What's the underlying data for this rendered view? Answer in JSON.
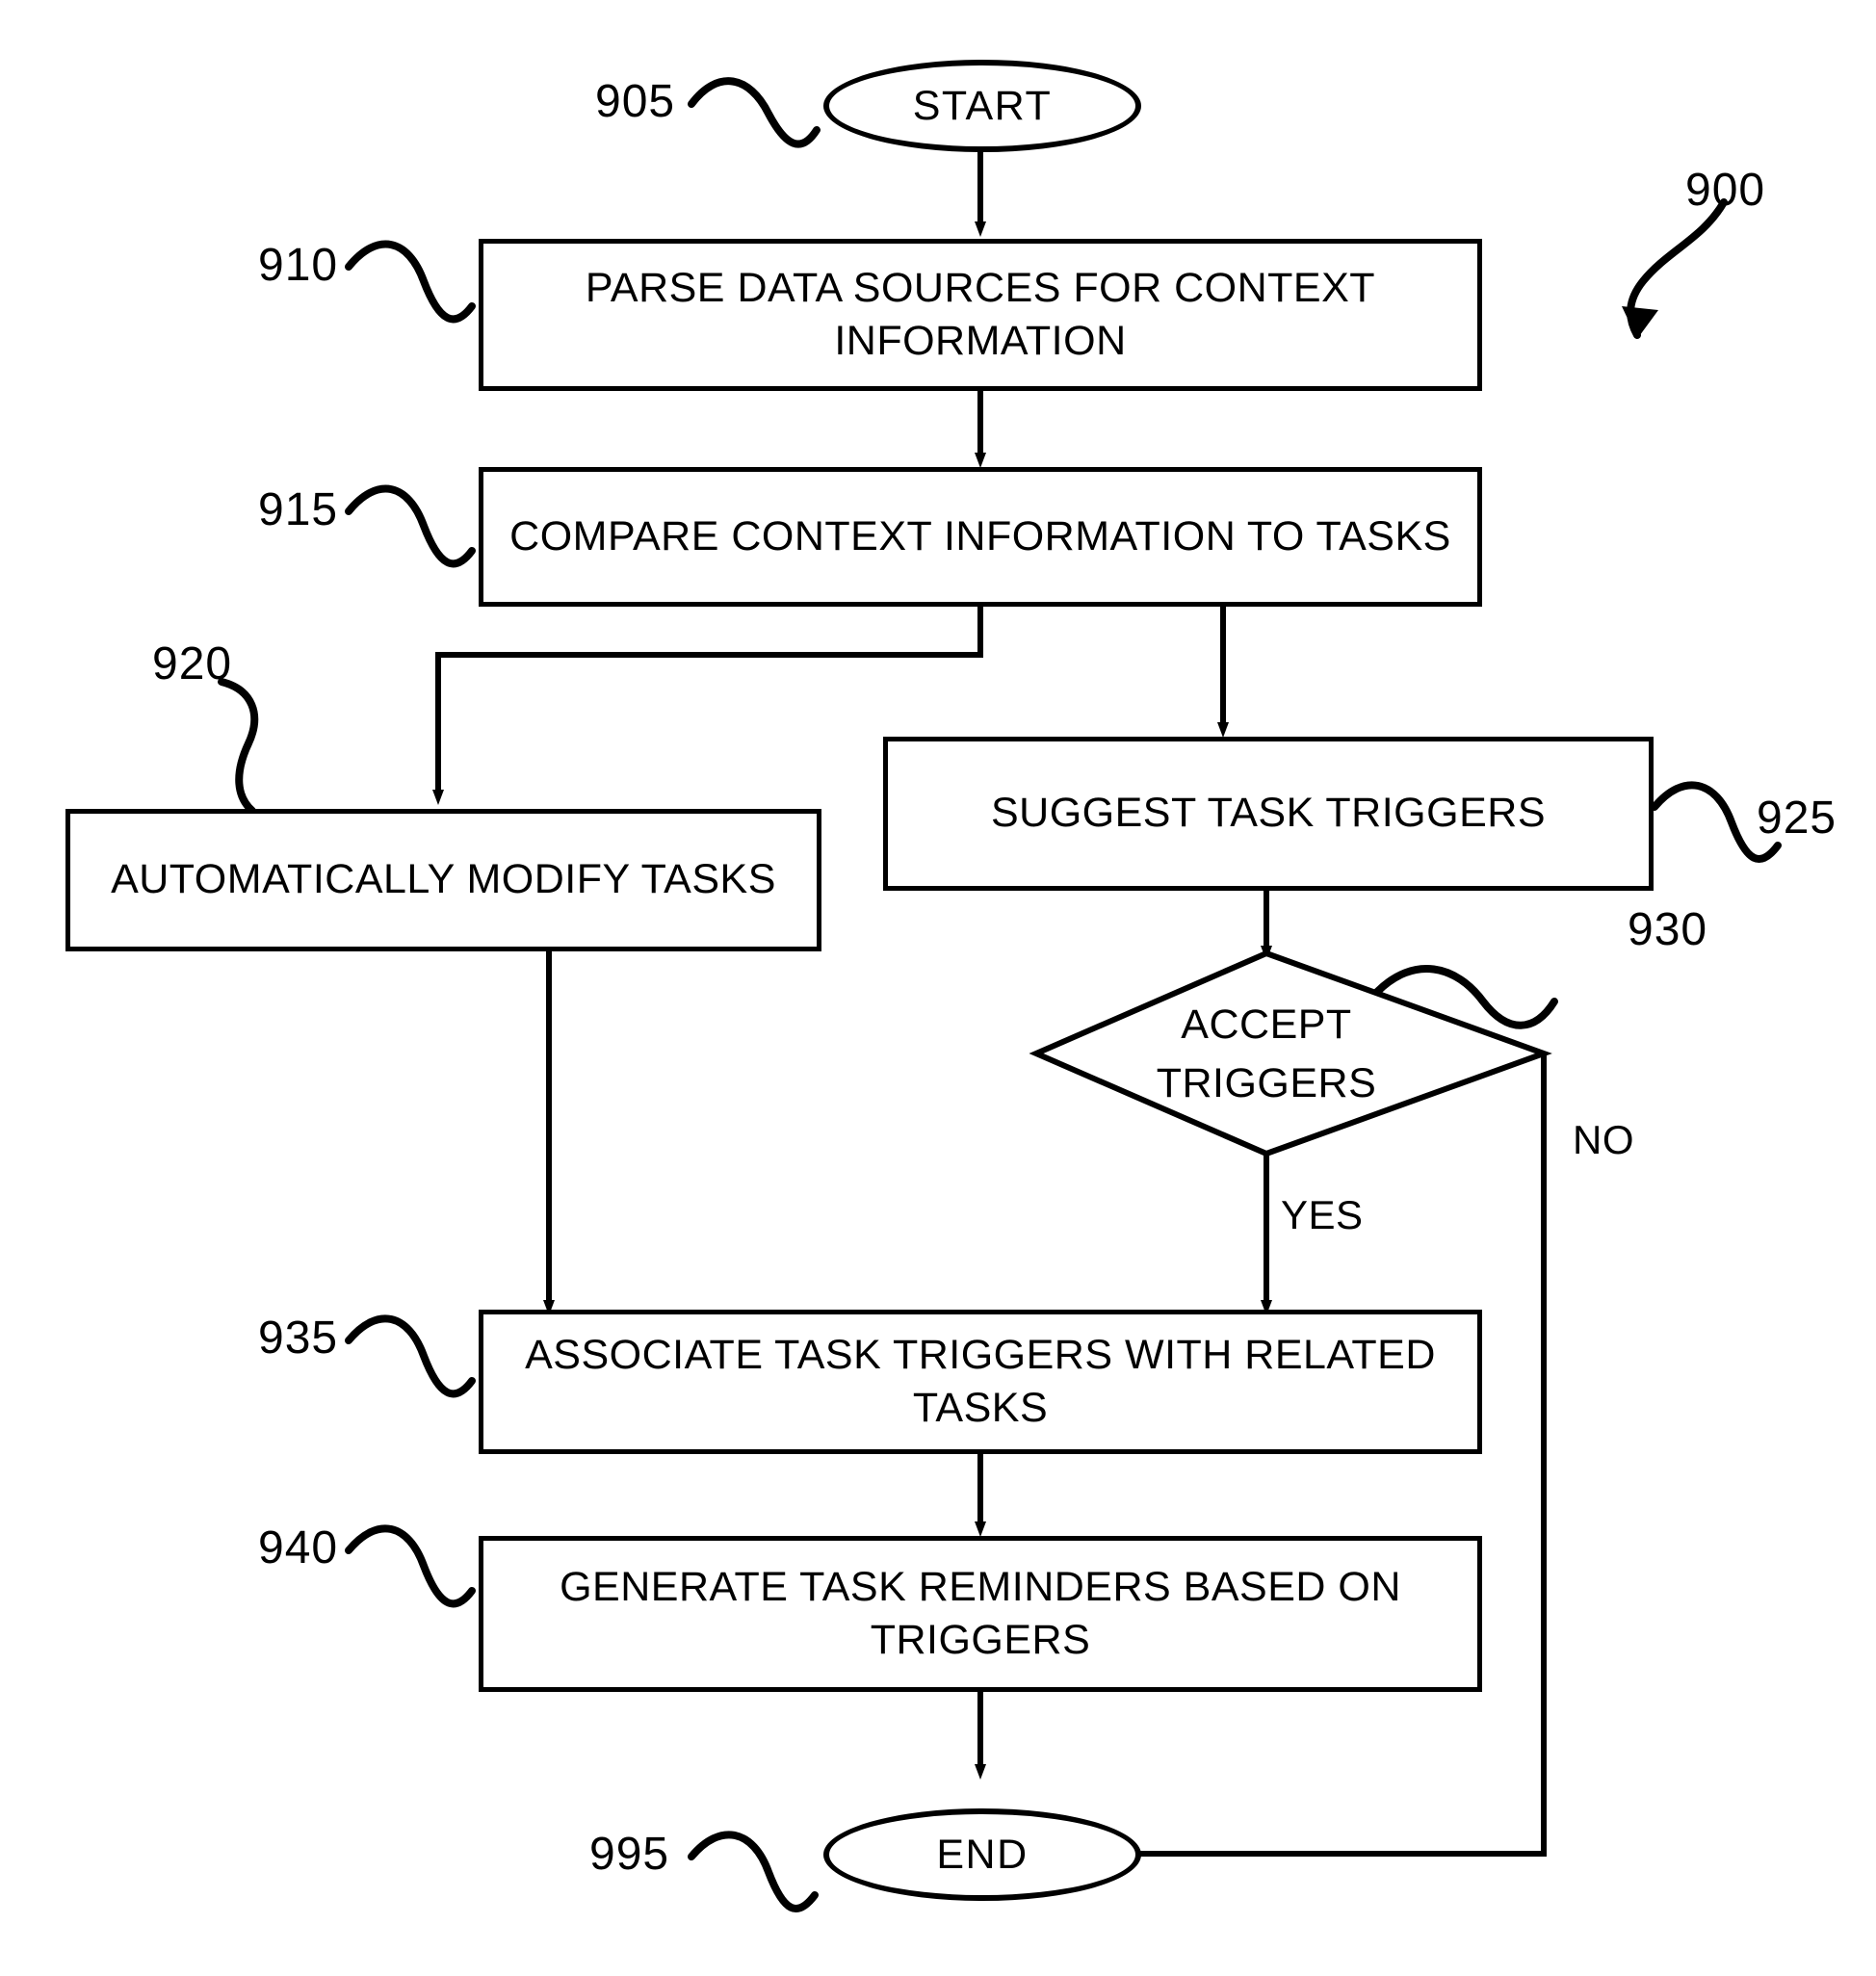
{
  "figure": {
    "number": "900",
    "title": "",
    "type": "flowchart"
  },
  "nodes": {
    "start": {
      "ref": "905",
      "label": "START",
      "shape": "terminator"
    },
    "parse": {
      "ref": "910",
      "label_line1": "PARSE DATA SOURCES FOR CONTEXT",
      "label_line2": "INFORMATION",
      "shape": "process"
    },
    "compare": {
      "ref": "915",
      "label_line1": "COMPARE CONTEXT INFORMATION TO TASKS",
      "label_line2": "",
      "shape": "process"
    },
    "modify": {
      "ref": "920",
      "label_line1": "AUTOMATICALLY MODIFY TASKS",
      "label_line2": "",
      "shape": "process"
    },
    "suggest": {
      "ref": "925",
      "label_line1": "SUGGEST TASK TRIGGERS",
      "label_line2": "",
      "shape": "process"
    },
    "decision": {
      "ref": "930",
      "label_line1": "ACCEPT",
      "label_line2": "TRIGGERS",
      "shape": "decision"
    },
    "associate": {
      "ref": "935",
      "label_line1": "ASSOCIATE TASK TRIGGERS WITH RELATED",
      "label_line2": "TASKS",
      "shape": "process"
    },
    "generate": {
      "ref": "940",
      "label_line1": "GENERATE TASK REMINDERS BASED ON",
      "label_line2": "TRIGGERS",
      "shape": "process"
    },
    "end": {
      "ref": "995",
      "label": "END",
      "shape": "terminator"
    }
  },
  "edge_labels": {
    "yes": "YES",
    "no": "NO"
  },
  "colors": {
    "stroke": "#000000",
    "background": "#ffffff",
    "text": "#000000"
  }
}
